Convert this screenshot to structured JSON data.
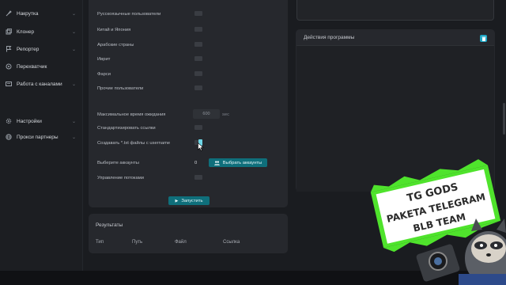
{
  "sidebar": {
    "items": [
      {
        "label": "Накрутка",
        "icon": "rocket-icon",
        "chevron": true
      },
      {
        "label": "Клонер",
        "icon": "copy-icon",
        "chevron": true
      },
      {
        "label": "Репортер",
        "icon": "flag-icon",
        "chevron": true
      },
      {
        "label": "Перехватчик",
        "icon": "intercept-icon",
        "chevron": false
      },
      {
        "label": "Работа с каналами",
        "icon": "channel-icon",
        "chevron": true
      },
      {
        "label": "Настройки",
        "icon": "gear-icon",
        "chevron": true
      },
      {
        "label": "Прокси партнеры",
        "icon": "globe-icon",
        "chevron": true
      }
    ]
  },
  "settings": {
    "rows": [
      {
        "label": "Русскоязычные пользователи"
      },
      {
        "label": "Китай и Япония"
      },
      {
        "label": "Арабские страны"
      },
      {
        "label": "Иврит"
      },
      {
        "label": "Фарси"
      },
      {
        "label": "Прочие пользователи"
      }
    ],
    "max_wait_label": "Максимальное время ожидания",
    "max_wait_value": "600",
    "max_wait_unit": "sec",
    "standardize_label": "Стандартизировать ссылки",
    "create_txt_label": "Создавать *.txt файлы с username",
    "select_accounts_label": "Выберите аккаунты",
    "select_accounts_count": "0",
    "select_accounts_button": "Выбрать аккаунты",
    "threads_label": "Управление потоками",
    "run_button": "Запустить"
  },
  "results": {
    "title": "Результаты",
    "columns": [
      "Тип",
      "Путь",
      "Файл",
      "Ссылка"
    ]
  },
  "actions_panel": {
    "title": "Действия программы"
  },
  "overlay": {
    "lines": [
      "TG GODS",
      "PAKETA TELEGRAM",
      "BLB TEAM"
    ]
  },
  "colors": {
    "accent": "#0f6f7b",
    "toggle_on": "#6fd6e6",
    "trash": "#1ea6c4",
    "sticker_green": "#4fe32c"
  }
}
